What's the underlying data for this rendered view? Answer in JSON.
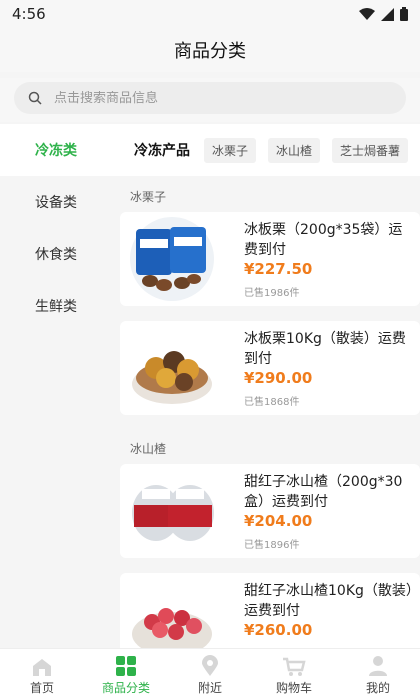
{
  "status": {
    "time": "4:56"
  },
  "header": {
    "title": "商品分类"
  },
  "search": {
    "placeholder": "点击搜索商品信息"
  },
  "sidebar": {
    "items": [
      {
        "label": "冷冻类"
      },
      {
        "label": "设备类"
      },
      {
        "label": "休食类"
      },
      {
        "label": "生鲜类"
      }
    ]
  },
  "category_bar": {
    "title": "冷冻产品",
    "chips": [
      "冰栗子",
      "冰山楂",
      "芝士焗番薯"
    ]
  },
  "groups": [
    {
      "label": "冰栗子",
      "products": [
        {
          "name": "冰板栗（200g*35袋）运费到付",
          "price": "¥227.50",
          "sold": "已售1986件",
          "image": "chestnut-bags"
        },
        {
          "name": "冰板栗10Kg（散装）运费到付",
          "price": "¥290.00",
          "sold": "已售1868件",
          "image": "chestnut-bowl"
        }
      ]
    },
    {
      "label": "冰山楂",
      "products": [
        {
          "name": "甜红子冰山楂（200g*30盒）运费到付",
          "price": "¥204.00",
          "sold": "已售1896件",
          "image": "hawthorn-boxes"
        },
        {
          "name": "甜红子冰山楂10Kg（散装）运费到付",
          "price": "¥260.00",
          "sold": "",
          "image": "hawthorn-bowl"
        }
      ]
    }
  ],
  "tabbar": {
    "items": [
      {
        "label": "首页",
        "icon": "home-icon"
      },
      {
        "label": "商品分类",
        "icon": "category-icon"
      },
      {
        "label": "附近",
        "icon": "location-icon"
      },
      {
        "label": "购物车",
        "icon": "cart-icon"
      },
      {
        "label": "我的",
        "icon": "user-icon"
      }
    ],
    "active": 1
  },
  "colors": {
    "accent": "#2eb24a",
    "price": "#f07c1c"
  }
}
